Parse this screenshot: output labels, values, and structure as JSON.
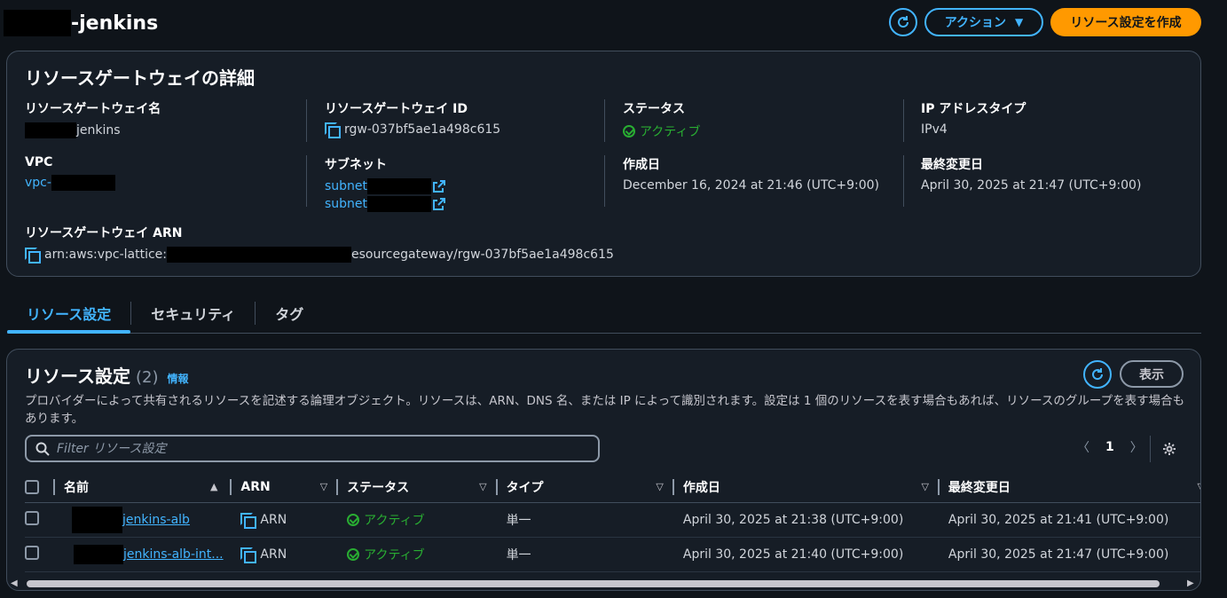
{
  "header": {
    "title_suffix": "-jenkins",
    "action_label": "アクション",
    "create_label": "リソース設定を作成"
  },
  "details": {
    "title": "リソースゲートウェイの詳細",
    "gateway_name_label": "リソースゲートウェイ名",
    "gateway_name_value": "jenkins",
    "gateway_id_label": "リソースゲートウェイ ID",
    "gateway_id_value": "rgw-037bf5ae1a498c615",
    "status_label": "ステータス",
    "status_value": "アクティブ",
    "ip_type_label": "IP アドレスタイプ",
    "ip_type_value": "IPv4",
    "vpc_label": "VPC",
    "vpc_value": "vpc-",
    "subnet_label": "サブネット",
    "subnets": [
      "subnet",
      "subnet"
    ],
    "created_label": "作成日",
    "created_value": "December 16, 2024 at 21:46 (UTC+9:00)",
    "modified_label": "最終変更日",
    "modified_value": "April 30, 2025 at 21:47 (UTC+9:00)",
    "arn_label": "リソースゲートウェイ ARN",
    "arn_prefix": "arn:aws:vpc-lattice:",
    "arn_suffix": "esourcegateway/rgw-037bf5ae1a498c615"
  },
  "tabs": [
    "リソース設定",
    "セキュリティ",
    "タグ"
  ],
  "resources": {
    "title": "リソース設定",
    "count": "(2)",
    "info": "情報",
    "show_label": "表示",
    "description": "プロバイダーによって共有されるリソースを記述する論理オブジェクト。リソースは、ARN、DNS 名、または IP によって識別されます。設定は 1 個のリソースを表す場合もあれば、リソースのグループを表す場合もあります。",
    "filter_placeholder": "Filter リソース設定",
    "page": "1",
    "columns": [
      "名前",
      "ARN",
      "ステータス",
      "タイプ",
      "作成日",
      "最終変更日"
    ],
    "rows": [
      {
        "name": "jenkins-alb",
        "arn": "ARN",
        "status": "アクティブ",
        "type": "単一",
        "created": "April 30, 2025 at 21:38 (UTC+9:00)",
        "modified": "April 30, 2025 at 21:41 (UTC+9:00)"
      },
      {
        "name": "jenkins-alb-int...",
        "arn": "ARN",
        "status": "アクティブ",
        "type": "単一",
        "created": "April 30, 2025 at 21:40 (UTC+9:00)",
        "modified": "April 30, 2025 at 21:47 (UTC+9:00)"
      }
    ]
  },
  "colors": {
    "accent": "#42b4ff",
    "primary": "#ff9900",
    "success": "#29ad32",
    "background": "#0f141a"
  }
}
